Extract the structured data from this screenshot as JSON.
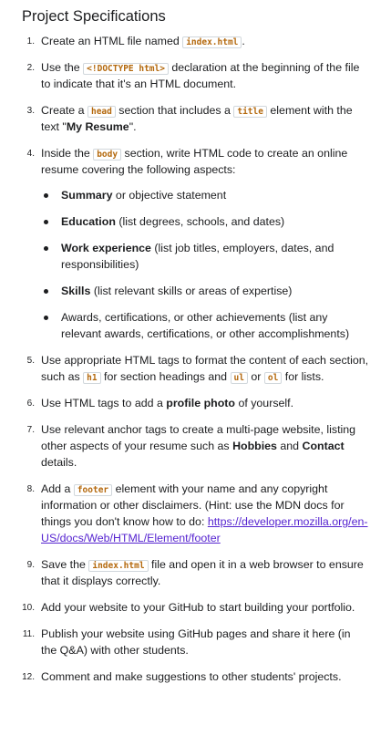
{
  "title": "Project Specifications",
  "colors": {
    "code_text": "#b4690e",
    "link": "#5624d0",
    "text": "#1c1d1f"
  },
  "steps": [
    {
      "n": "1.",
      "a": "Create an HTML file named ",
      "code": "index.html",
      "b": "."
    },
    {
      "n": "2.",
      "a": "Use the ",
      "code": "<!DOCTYPE html>",
      "b": " declaration at the beginning of the file to indicate that it's an HTML document."
    },
    {
      "n": "3.",
      "a": "Create a ",
      "code1": "head",
      "b": " section that includes a ",
      "code2": "title",
      "c": " element with the text \"",
      "bold": "My Resume",
      "d": "\"."
    },
    {
      "n": "4.",
      "a": "Inside the ",
      "code": "body",
      "b": " section, write HTML code to create an online resume covering the following aspects:",
      "aspects": [
        {
          "bold": "Summary",
          "rest": " or objective statement"
        },
        {
          "bold": "Education",
          "rest": " (list degrees, schools, and dates)"
        },
        {
          "bold": "Work experience",
          "rest": " (list job titles, employers, dates, and responsibilities)"
        },
        {
          "bold": "Skills",
          "rest": " (list relevant skills or areas of expertise)"
        },
        {
          "bold": "",
          "rest": "Awards, certifications, or other achievements (list any relevant awards, certifications, or other accomplishments)"
        }
      ]
    },
    {
      "n": "5.",
      "a": "Use appropriate HTML tags to format the content of each section, such as ",
      "code1": "h1",
      "b": " for section headings and ",
      "code2": "ul",
      "c": " or ",
      "code3": "ol",
      "d": " for lists."
    },
    {
      "n": "6.",
      "a": "Use HTML tags to add a ",
      "bold": "profile photo",
      "b": " of yourself."
    },
    {
      "n": "7.",
      "a": "Use relevant anchor tags to create a multi-page website, listing other aspects of your resume such as ",
      "bold1": "Hobbies",
      "b": " and ",
      "bold2": "Contact",
      "c": " details."
    },
    {
      "n": "8.",
      "a": "Add a ",
      "code": "footer",
      "b": " element with your name and any copyright information or other disclaimers. (Hint: use the MDN docs for things you don't know how to do: ",
      "link": "https://developer.mozilla.org/en-US/docs/Web/HTML/Element/footer"
    },
    {
      "n": "9.",
      "a": "Save the ",
      "code": "index.html",
      "b": " file and open it in a web browser to ensure that it displays correctly."
    },
    {
      "n": "10.",
      "a": "Add your website to your GitHub to start building your portfolio."
    },
    {
      "n": "11.",
      "a": "Publish your website using GitHub pages and share it here (in the Q&A) with other students."
    },
    {
      "n": "12.",
      "a": "Comment and make suggestions to other students' projects."
    }
  ]
}
